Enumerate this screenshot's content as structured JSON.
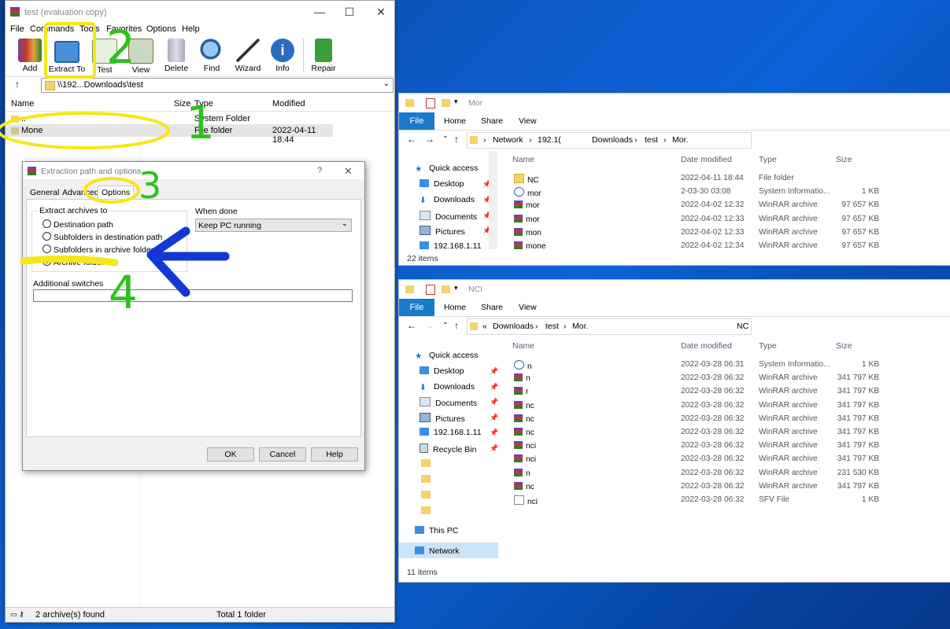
{
  "winrar": {
    "title": "test (evaluation copy)",
    "menu": [
      "File",
      "Commands",
      "Tools",
      "Favorites",
      "Options",
      "Help"
    ],
    "toolbar": [
      "Add",
      "Extract To",
      "Test",
      "View",
      "Delete",
      "Find",
      "Wizard",
      "Info",
      "Repair"
    ],
    "address": "\\\\192...Downloads\\test",
    "columns": {
      "name": "Name",
      "size": "Size",
      "type": "Type",
      "modified": "Modified"
    },
    "rows": [
      {
        "name": "..",
        "type": "System Folder",
        "modified": ""
      },
      {
        "name": "Mone",
        "type": "File folder",
        "modified": "2022-04-11 18:44"
      }
    ],
    "status_left": "2 archive(s) found",
    "status_right": "Total 1 folder"
  },
  "dialog": {
    "title": "Extraction path and options",
    "help": "?",
    "tabs": [
      "General",
      "Advanced",
      "Options"
    ],
    "extract_group": "Extract archives to",
    "radios": [
      "Destination path",
      "Subfolders in destination path",
      "Subfolders in archive folders",
      "Archive folders"
    ],
    "selected_radio": 3,
    "when_done_label": "When done",
    "when_done_value": "Keep PC running",
    "switches_label": "Additional switches",
    "buttons": {
      "ok": "OK",
      "cancel": "Cancel",
      "help": "Help"
    }
  },
  "annotations": [
    "1",
    "2",
    "3",
    "4"
  ],
  "explorer1": {
    "title": "Mor",
    "ribbon": [
      "File",
      "Home",
      "Share",
      "View"
    ],
    "path": [
      "Network",
      "192.1(",
      "Downloads",
      "test",
      "Mor."
    ],
    "tree": [
      "Quick access",
      "Desktop",
      "Downloads",
      "Documents",
      "Pictures",
      "192.168.1.11"
    ],
    "headers": {
      "name": "Name",
      "date": "Date modified",
      "type": "Type",
      "size": "Size"
    },
    "files": [
      {
        "icon": "folder",
        "name": "NC",
        "date": "2022-04-11 18:44",
        "type": "File folder",
        "size": ""
      },
      {
        "icon": "sys",
        "name": "mor",
        "date": "2-03-30 03:08",
        "type": "System Informatio...",
        "size": "1 KB"
      },
      {
        "icon": "rar",
        "name": "mor",
        "date": "2022-04-02 12:32",
        "type": "WinRAR archive",
        "size": "97 657 KB"
      },
      {
        "icon": "rar",
        "name": "mor",
        "date": "2022-04-02 12:33",
        "type": "WinRAR archive",
        "size": "97 657 KB"
      },
      {
        "icon": "rar",
        "name": "mon",
        "date": "2022-04-02 12:33",
        "type": "WinRAR archive",
        "size": "97 657 KB"
      },
      {
        "icon": "rar",
        "name": "mone",
        "date": "2022-04-02 12:34",
        "type": "WinRAR archive",
        "size": "97 657 KB"
      }
    ],
    "count": "22 items"
  },
  "explorer2": {
    "title": "NCI",
    "ribbon": [
      "File",
      "Home",
      "Share",
      "View"
    ],
    "path": [
      "«",
      "Downloads",
      "test",
      "Mor.",
      "NC"
    ],
    "tree": [
      "Quick access",
      "Desktop",
      "Downloads",
      "Documents",
      "Pictures",
      "192.168.1.11",
      "Recycle Bin",
      "This PC",
      "Network"
    ],
    "headers": {
      "name": "Name",
      "date": "Date modified",
      "type": "Type",
      "size": "Size"
    },
    "files": [
      {
        "icon": "sys",
        "name": "n",
        "date": "2022-03-28 06:31",
        "type": "System Informatio...",
        "size": "1 KB"
      },
      {
        "icon": "rar",
        "name": "n",
        "date": "2022-03-28 06:32",
        "type": "WinRAR archive",
        "size": "341 797 KB"
      },
      {
        "icon": "rar",
        "name": "r",
        "date": "2022-03-28 06:32",
        "type": "WinRAR archive",
        "size": "341 797 KB"
      },
      {
        "icon": "rar",
        "name": "nc",
        "date": "2022-03-28 06:32",
        "type": "WinRAR archive",
        "size": "341 797 KB"
      },
      {
        "icon": "rar",
        "name": "nc",
        "date": "2022-03-28 06:32",
        "type": "WinRAR archive",
        "size": "341 797 KB"
      },
      {
        "icon": "rar",
        "name": "nc",
        "date": "2022-03-28 06:32",
        "type": "WinRAR archive",
        "size": "341 797 KB"
      },
      {
        "icon": "rar",
        "name": "nci",
        "date": "2022-03-28 06:32",
        "type": "WinRAR archive",
        "size": "341 797 KB"
      },
      {
        "icon": "rar",
        "name": "nci",
        "date": "2022-03-28 06:32",
        "type": "WinRAR archive",
        "size": "341 797 KB"
      },
      {
        "icon": "rar",
        "name": "n",
        "date": "2022-03-28 06:32",
        "type": "WinRAR archive",
        "size": "231 530 KB"
      },
      {
        "icon": "rar",
        "name": "nc",
        "date": "2022-03-28 06:32",
        "type": "WinRAR archive",
        "size": "341 797 KB"
      },
      {
        "icon": "sfv",
        "name": "nci",
        "date": "2022-03-28 06:32",
        "type": "SFV File",
        "size": "1 KB"
      }
    ],
    "count": "11 items"
  }
}
